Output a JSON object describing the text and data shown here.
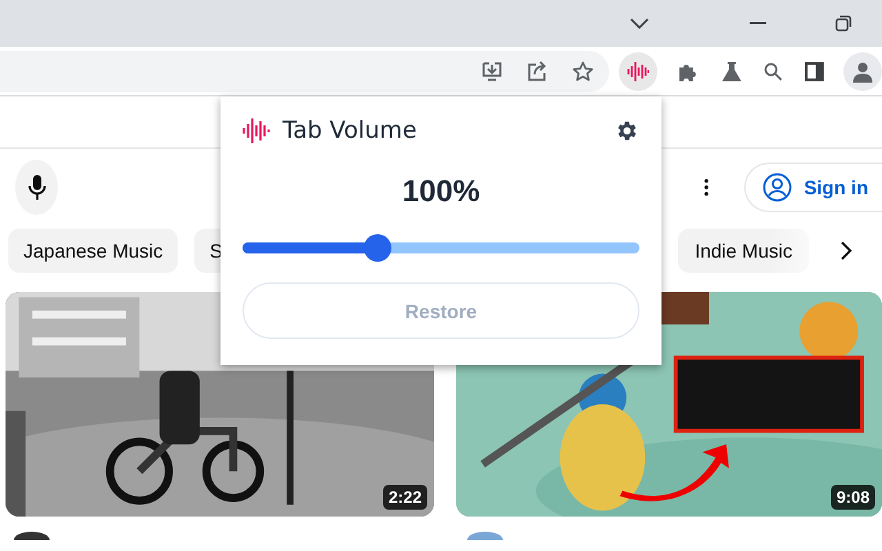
{
  "popup": {
    "title": "Tab Volume",
    "volume": "100%",
    "level": 0.34,
    "restore": {
      "label": "Restore",
      "disabled": true
    }
  },
  "header": {
    "sign_in": "Sign in"
  },
  "chips": [
    {
      "label": "Japanese Music"
    },
    {
      "label": "S"
    },
    {
      "label": "Indie Music"
    }
  ],
  "videos": [
    {
      "kind": "picture",
      "duration": "2:22"
    },
    {
      "kind": "picture",
      "duration": "9:08"
    }
  ]
}
